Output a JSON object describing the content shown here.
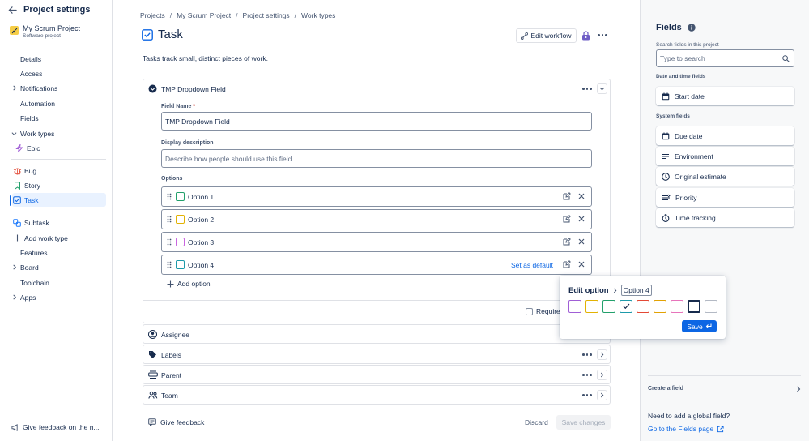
{
  "sidebar": {
    "title": "Project settings",
    "project_name": "My Scrum Project",
    "project_type": "Software project",
    "items": {
      "details": "Details",
      "access": "Access",
      "notifications": "Notifications",
      "automation": "Automation",
      "fields": "Fields",
      "work_types": "Work types",
      "epic": "Epic",
      "bug": "Bug",
      "story": "Story",
      "task": "Task",
      "subtask": "Subtask",
      "add_work_type": "Add work type",
      "features": "Features",
      "board": "Board",
      "toolchain": "Toolchain",
      "apps": "Apps"
    },
    "feedback": "Give feedback on the n..."
  },
  "breadcrumb": [
    "Projects",
    "My Scrum Project",
    "Project settings",
    "Work types"
  ],
  "header": {
    "title": "Task",
    "edit_workflow": "Edit workflow",
    "description": "Tasks track small, distinct pieces of work."
  },
  "field_card": {
    "title": "TMP Dropdown Field",
    "field_name_label": "Field Name",
    "field_name_value": "TMP Dropdown Field",
    "display_desc_label": "Display description",
    "display_desc_placeholder": "Describe how people should use this field",
    "options_label": "Options",
    "options": [
      {
        "label": "Option 1",
        "color": "#22a06b"
      },
      {
        "label": "Option 2",
        "color": "#e2b203"
      },
      {
        "label": "Option 3",
        "color": "#c966e0"
      },
      {
        "label": "Option 4",
        "color": "#1d9aaa"
      }
    ],
    "set_as_default": "Set as default",
    "add_option": "Add option",
    "required": "Require"
  },
  "rows": [
    "Assignee",
    "Labels",
    "Parent",
    "Team"
  ],
  "footer": {
    "give_feedback": "Give feedback",
    "discard": "Discard",
    "save_changes": "Save changes"
  },
  "popup": {
    "title": "Edit option",
    "option_chip": "Option 4",
    "swatch_colors": [
      "#a05ed6",
      "#e2b203",
      "#22a06b",
      "#1d9aaa",
      "#e34935",
      "#e2a203",
      "#e774bb",
      "#172b4d",
      "#8590a2"
    ],
    "selected_index": 3,
    "save": "Save"
  },
  "right_panel": {
    "title": "Fields",
    "search_label": "Search fields in this project",
    "search_placeholder": "Type to search",
    "date_section": "Date and time fields",
    "date_fields": [
      "Start date"
    ],
    "system_section": "System fields",
    "system_fields": [
      "Due date",
      "Environment",
      "Original estimate",
      "Priority",
      "Time tracking"
    ],
    "create_field": "Create a field",
    "need_global": "Need to add a global field?",
    "go_fields": "Go to the Fields page"
  },
  "colors": {
    "accent": "#0c66e4",
    "active_bg": "#e9f2ff",
    "text": "#172b4d",
    "muted": "#44546f"
  }
}
